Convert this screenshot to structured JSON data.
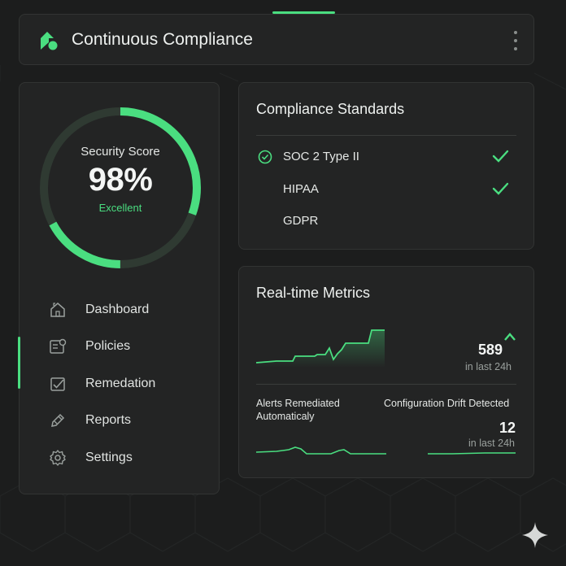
{
  "header": {
    "title": "Continuous Compliance",
    "logo_icon": "leaf-logo-icon",
    "menu_icon": "kebab-menu-icon"
  },
  "score": {
    "label": "Security Score",
    "value": "98%",
    "status": "Excellent",
    "percent": 98
  },
  "nav": {
    "items": [
      {
        "label": "Dashboard",
        "icon": "home-icon",
        "active": false
      },
      {
        "label": "Policies",
        "icon": "policy-document-icon",
        "active": true
      },
      {
        "label": "Remedation",
        "icon": "checkbox-icon",
        "active": true
      },
      {
        "label": "Reports",
        "icon": "pen-icon",
        "active": false
      },
      {
        "label": "Settings",
        "icon": "gear-icon",
        "active": false
      }
    ]
  },
  "standards": {
    "title": "Compliance Standards",
    "items": [
      {
        "label": "SOC 2 Type II",
        "status_icon": "check-circle-icon",
        "checked": true
      },
      {
        "label": "HIPAA",
        "checked": true
      },
      {
        "label": "GDPR",
        "checked": false
      }
    ]
  },
  "metrics": {
    "title": "Real-time Metrics",
    "primary": {
      "value": "589",
      "period": "in last 24h",
      "trend_icon": "chevron-up-icon"
    },
    "alerts": {
      "label_line1": "Alerts Remediated",
      "label_line2": "Automaticaly"
    },
    "drift": {
      "label": "Configuration Drift Detected",
      "value": "12",
      "period": "in last 24h"
    }
  },
  "colors": {
    "accent": "#4ade80",
    "background": "#1c1d1d",
    "panel": "#232424",
    "gauge_track": "#2f3a32"
  },
  "corner_icon": "sparkle-icon"
}
